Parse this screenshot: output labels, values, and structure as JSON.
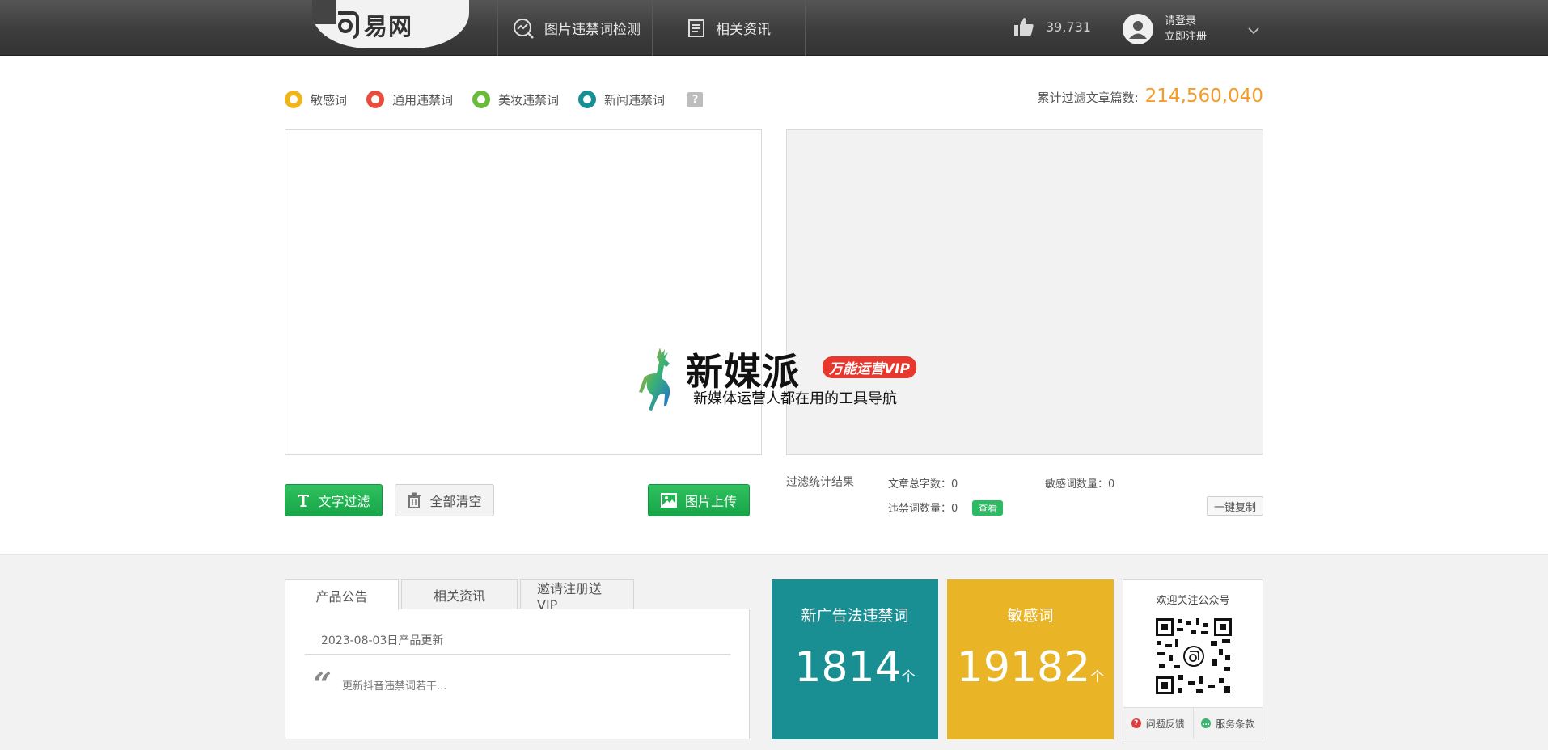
{
  "brand": {
    "logo_text": "易网"
  },
  "nav": {
    "items": [
      {
        "label": "图片违禁词检测",
        "icon": "image-scan-icon"
      },
      {
        "label": "相关资讯",
        "icon": "news-doc-icon"
      }
    ],
    "likes": "39,731",
    "user": {
      "login": "请登录",
      "register": "立即注册"
    }
  },
  "filters": {
    "options": [
      {
        "label": "敏感词",
        "color": "#f0b51c"
      },
      {
        "label": "通用违禁词",
        "color": "#e84c3d"
      },
      {
        "label": "美妆违禁词",
        "color": "#6aba3c"
      },
      {
        "label": "新闻违禁词",
        "color": "#169094"
      }
    ],
    "help": "?"
  },
  "total": {
    "label": "累计过滤文章篇数:",
    "value": "214,560,040"
  },
  "actions": {
    "text_filter": "文字过滤",
    "clear_all": "全部清空",
    "image_upload": "图片上传"
  },
  "stats": {
    "title": "过滤统计结果",
    "total_chars": "文章总字数：0",
    "sensitive_count": "敏感词数量：0",
    "banned_count": "违禁词数量：0",
    "view": "查看",
    "copy": "一键复制"
  },
  "notice": {
    "tabs": [
      "产品公告",
      "相关资讯",
      "邀请注册送VIP"
    ],
    "date": "2023-08-03日产品更新",
    "text": "更新抖音违禁词若干..."
  },
  "cards": [
    {
      "title": "新广告法违禁词",
      "value": "1814",
      "unit": "个",
      "color": "#1a8f93"
    },
    {
      "title": "敏感词",
      "value": "19182",
      "unit": "个",
      "color": "#e9b526"
    }
  ],
  "qr": {
    "title": "欢迎关注公众号",
    "feedback": "问题反馈",
    "terms": "服务条款"
  },
  "watermark": {
    "title": "新媒派",
    "badge": "万能运营VIP",
    "subtitle": "新媒体运营人都在用的工具导航"
  }
}
